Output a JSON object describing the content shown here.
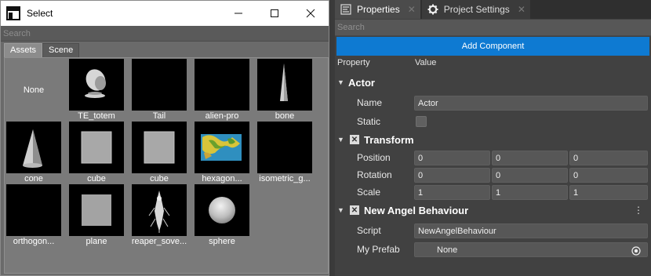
{
  "select_window": {
    "title": "Select",
    "search_placeholder": "Search",
    "tabs": [
      {
        "label": "Assets",
        "active": true
      },
      {
        "label": "Scene",
        "active": false
      }
    ],
    "assets": [
      {
        "label": "None",
        "icon": "none"
      },
      {
        "label": "TE_totem",
        "icon": "totem-thumb"
      },
      {
        "label": "Tail",
        "icon": "empty-thumb"
      },
      {
        "label": "alien-pro",
        "icon": "empty-thumb"
      },
      {
        "label": "bone",
        "icon": "bone-thumb"
      },
      {
        "label": "cone",
        "icon": "cone-thumb"
      },
      {
        "label": "cube",
        "icon": "cube-thumb"
      },
      {
        "label": "cube",
        "icon": "cube-thumb"
      },
      {
        "label": "hexagon...",
        "icon": "hexagon-map-thumb"
      },
      {
        "label": "isometric_g...",
        "icon": "empty-thumb"
      },
      {
        "label": "orthogon...",
        "icon": "ortho-thumb"
      },
      {
        "label": "plane",
        "icon": "plane-thumb"
      },
      {
        "label": "reaper_sove...",
        "icon": "reaper-thumb"
      },
      {
        "label": "sphere",
        "icon": "sphere-thumb"
      }
    ]
  },
  "dock": {
    "tabs": [
      {
        "label": "Properties",
        "icon": "properties-icon",
        "active": true
      },
      {
        "label": "Project Settings",
        "icon": "gear-icon",
        "active": false
      }
    ],
    "search_placeholder": "Search",
    "add_component_label": "Add Component",
    "columns": {
      "property": "Property",
      "value": "Value"
    },
    "actor": {
      "header": "Actor",
      "name_label": "Name",
      "name_value": "Actor",
      "static_label": "Static"
    },
    "transform": {
      "header": "Transform",
      "position_label": "Position",
      "position": [
        "0",
        "0",
        "0"
      ],
      "rotation_label": "Rotation",
      "rotation": [
        "0",
        "0",
        "0"
      ],
      "scale_label": "Scale",
      "scale": [
        "1",
        "1",
        "1"
      ]
    },
    "behaviour": {
      "header": "New Angel Behaviour",
      "script_label": "Script",
      "script_value": "NewAngelBehaviour",
      "prefab_label": "My Prefab",
      "prefab_value": "None"
    }
  },
  "colors": {
    "accent": "#0e7ad2",
    "panel_bg": "#414141",
    "select_bg": "#7a7a7a"
  }
}
